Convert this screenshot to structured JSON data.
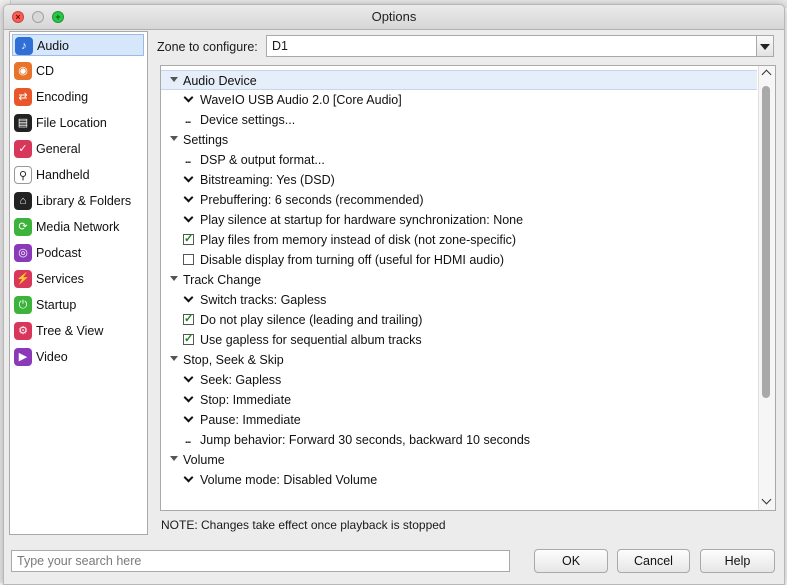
{
  "window": {
    "title": "Options"
  },
  "sidebar": {
    "items": [
      {
        "label": "Audio",
        "icon": "music-note-icon",
        "color": "#2f6fd6",
        "glyph": "♪",
        "selected": true
      },
      {
        "label": "CD",
        "icon": "cd-icon",
        "color": "#e8732a",
        "glyph": "◉"
      },
      {
        "label": "Encoding",
        "icon": "encoding-icon",
        "color": "#e8562a",
        "glyph": "⇄"
      },
      {
        "label": "File Location",
        "icon": "file-location-icon",
        "color": "#222222",
        "glyph": "▤"
      },
      {
        "label": "General",
        "icon": "general-checkbox-icon",
        "color": "#d8365a",
        "glyph": "✓"
      },
      {
        "label": "Handheld",
        "icon": "usb-icon",
        "color": "#ffffff",
        "glyph": "⚲"
      },
      {
        "label": "Library & Folders",
        "icon": "library-house-icon",
        "color": "#222222",
        "glyph": "⌂"
      },
      {
        "label": "Media Network",
        "icon": "media-network-icon",
        "color": "#3cb43c",
        "glyph": "⟳"
      },
      {
        "label": "Podcast",
        "icon": "podcast-icon",
        "color": "#8a3ab9",
        "glyph": "◎"
      },
      {
        "label": "Services",
        "icon": "plug-icon",
        "color": "#d8365a",
        "glyph": "⚡"
      },
      {
        "label": "Startup",
        "icon": "power-icon",
        "color": "#3cb43c",
        "glyph": "⏻"
      },
      {
        "label": "Tree & View",
        "icon": "gear-icon",
        "color": "#d8365a",
        "glyph": "⚙"
      },
      {
        "label": "Video",
        "icon": "video-camera-icon",
        "color": "#8a3ab9",
        "glyph": "▶"
      }
    ]
  },
  "zone": {
    "label": "Zone to configure:",
    "value": "D1"
  },
  "tree": {
    "rows": [
      {
        "kind": "header",
        "label": "Audio Device",
        "selected": true
      },
      {
        "kind": "chevron",
        "label": "WaveIO USB Audio 2.0 [Core Audio]"
      },
      {
        "kind": "dots",
        "label": "Device settings..."
      },
      {
        "kind": "header",
        "label": "Settings"
      },
      {
        "kind": "dots",
        "label": "DSP & output format..."
      },
      {
        "kind": "chevron",
        "label": "Bitstreaming: Yes (DSD)"
      },
      {
        "kind": "chevron",
        "label": "Prebuffering: 6 seconds (recommended)"
      },
      {
        "kind": "chevron",
        "label": "Play silence at startup for hardware synchronization: None"
      },
      {
        "kind": "check",
        "checked": true,
        "label": "Play files from memory instead of disk (not zone-specific)"
      },
      {
        "kind": "check",
        "checked": false,
        "label": "Disable display from turning off (useful for HDMI audio)"
      },
      {
        "kind": "header",
        "label": "Track Change"
      },
      {
        "kind": "chevron",
        "label": "Switch tracks: Gapless"
      },
      {
        "kind": "check",
        "checked": true,
        "label": "Do not play silence (leading and trailing)"
      },
      {
        "kind": "check",
        "checked": true,
        "label": "Use gapless for sequential album tracks"
      },
      {
        "kind": "header",
        "label": "Stop, Seek & Skip"
      },
      {
        "kind": "chevron",
        "label": "Seek: Gapless"
      },
      {
        "kind": "chevron",
        "label": "Stop: Immediate"
      },
      {
        "kind": "chevron",
        "label": "Pause: Immediate"
      },
      {
        "kind": "dots",
        "label": "Jump behavior: Forward 30 seconds, backward 10 seconds"
      },
      {
        "kind": "header",
        "label": "Volume"
      },
      {
        "kind": "chevron",
        "label": "Volume mode: Disabled Volume"
      }
    ]
  },
  "note": "NOTE: Changes take effect once playback is stopped",
  "search": {
    "placeholder": "Type your search here"
  },
  "buttons": {
    "ok": "OK",
    "cancel": "Cancel",
    "help": "Help"
  }
}
